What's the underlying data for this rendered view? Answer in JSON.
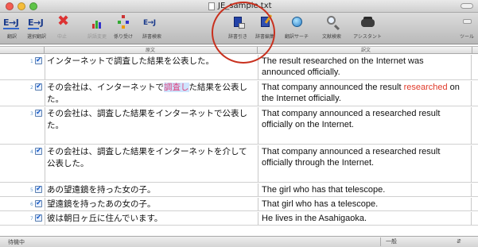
{
  "window": {
    "title": "JE_sample.txt"
  },
  "toolbar": {
    "items": [
      {
        "label": "翻訳",
        "icon": "translate-je-icon"
      },
      {
        "label": "選択翻訳",
        "icon": "translate-selection-icon"
      },
      {
        "label": "中止",
        "icon": "stop-icon"
      },
      {
        "label": "訳語変更",
        "icon": "change-translation-icon"
      },
      {
        "label": "係り受け",
        "icon": "dependency-icon"
      },
      {
        "label": "辞書検索",
        "icon": "dictionary-lookup-icon"
      },
      {
        "label": "辞書引き",
        "icon": "dictionary-icon"
      },
      {
        "label": "辞書編集",
        "icon": "dictionary-edit-icon"
      },
      {
        "label": "翻訳サーチ",
        "icon": "translation-search-icon"
      },
      {
        "label": "文献検索",
        "icon": "document-search-icon"
      },
      {
        "label": "アシスタント",
        "icon": "assistant-icon"
      },
      {
        "label": "ツール",
        "icon": "tools-icon"
      }
    ]
  },
  "table": {
    "columns": {
      "source": "原文",
      "translation": "訳文"
    },
    "rows": [
      {
        "num": "1",
        "src": "インターネットで調査した結果を公表した。",
        "dst": "The result researched on the Internet was announced officially."
      },
      {
        "num": "2",
        "src_before": "その会社は、インターネットで",
        "src_highlight": "調査し",
        "src_after": "た結果を公表した。",
        "dst_before": "That company announced the result ",
        "dst_highlight": "researched",
        "dst_after": " on the Internet officially."
      },
      {
        "num": "3",
        "src": "その会社は、調査した結果をインターネットで公表した。",
        "dst": "That company announced a researched result officially on the Internet."
      },
      {
        "num": "4",
        "src": "その会社は、調査した結果をインターネットを介して公表した。",
        "dst": "That company announced a researched result officially through the Internet."
      },
      {
        "num": "5",
        "src": "あの望遠鏡を持った女の子。",
        "dst": "The girl who has that telescope."
      },
      {
        "num": "6",
        "src": "望遠鏡を持ったあの女の子。",
        "dst": "That girl who has a telescope."
      },
      {
        "num": "7",
        "src": "彼は朝日ヶ丘に住んでいます。",
        "dst": "He lives in the Asahigaoka."
      }
    ]
  },
  "status": {
    "text": "待機中",
    "mode": "一般"
  },
  "colors": {
    "highlight": "#e03a2a",
    "annotation_circle": "#c8301e"
  }
}
